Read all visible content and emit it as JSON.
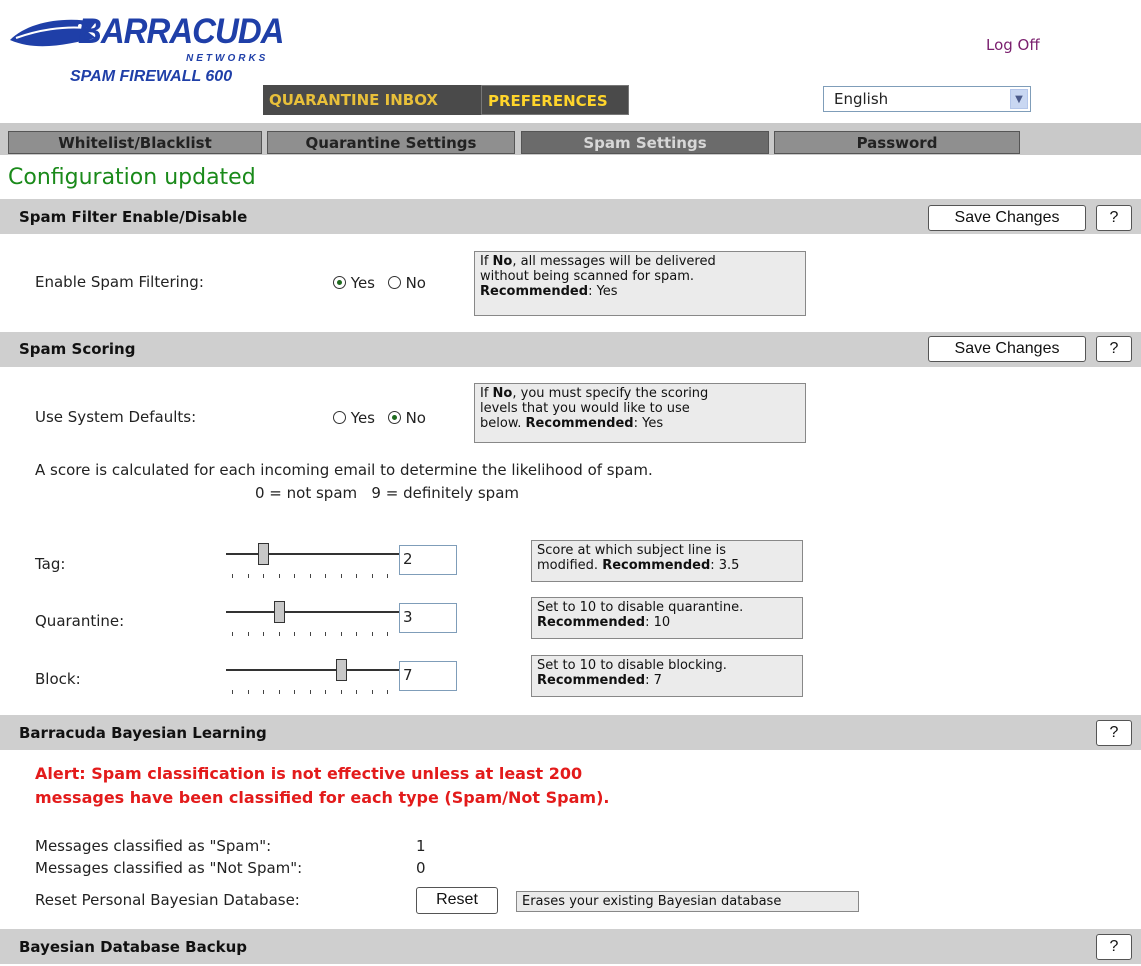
{
  "header": {
    "logo_word": "BARRACUDA",
    "logo_networks": "NETWORKS",
    "logo_product": "SPAM FIREWALL 600",
    "logoff": "Log Off",
    "tabs": [
      {
        "label": "QUARANTINE INBOX"
      },
      {
        "label": "PREFERENCES"
      }
    ],
    "language": "English"
  },
  "subnav": [
    {
      "label": "Whitelist/Blacklist"
    },
    {
      "label": "Quarantine Settings"
    },
    {
      "label": "Spam Settings",
      "active": true
    },
    {
      "label": "Password"
    }
  ],
  "status_message": "Configuration updated",
  "sections": {
    "filter": {
      "title": "Spam Filter Enable/Disable",
      "save_label": "Save Changes",
      "help_label": "?",
      "field_label": "Enable Spam Filtering:",
      "options": [
        "Yes",
        "No"
      ],
      "selected": "Yes",
      "note_line1_bold": "No",
      "note_line1_pre": "If ",
      "note_line1_post": ", all messages will be delivered",
      "note_line2": "without being scanned for spam.",
      "note_line3_bold": "Recommended",
      "note_line3_post": ": Yes"
    },
    "scoring": {
      "title": "Spam Scoring",
      "save_label": "Save Changes",
      "help_label": "?",
      "field_label": "Use System Defaults:",
      "options": [
        "Yes",
        "No"
      ],
      "selected": "No",
      "note_line1_pre": "If ",
      "note_line1_bold": "No",
      "note_line1_post": ", you must specify the scoring",
      "note_line2": "levels that you would like to use",
      "note_line3_pre": "below. ",
      "note_line3_bold": "Recommended",
      "note_line3_post": ": Yes",
      "desc_line1": "A score is calculated for each incoming email to determine the likelihood of spam.",
      "desc_line2": "0 = not spam   9 = definitely spam",
      "sliders": [
        {
          "label": "Tag:",
          "value": "2",
          "level": 2,
          "note1": "Score at which subject line is",
          "note2_pre": "modified. ",
          "note2_bold": "Recommended",
          "note2_post": ": 3.5"
        },
        {
          "label": "Quarantine:",
          "value": "3",
          "level": 3,
          "note1": "Set to 10 to disable quarantine.",
          "note2_pre": "",
          "note2_bold": "Recommended",
          "note2_post": ": 10"
        },
        {
          "label": "Block:",
          "value": "7",
          "level": 7,
          "note1": "Set to 10 to disable blocking.",
          "note2_pre": "",
          "note2_bold": "Recommended",
          "note2_post": ": 7"
        }
      ]
    },
    "bayesian": {
      "title": "Barracuda Bayesian Learning",
      "help_label": "?",
      "alert_line1": "Alert: Spam classification is not effective unless at least 200",
      "alert_line2": "messages have been classified for each type (Spam/Not Spam).",
      "spam_label": "Messages classified as \"Spam\":",
      "spam_count": "1",
      "notspam_label": "Messages classified as \"Not Spam\":",
      "notspam_count": "0",
      "reset_label": "Reset Personal Bayesian Database:",
      "reset_button": "Reset",
      "reset_note": "Erases your existing Bayesian database"
    },
    "backup": {
      "title": "Bayesian Database Backup",
      "help_label": "?"
    }
  },
  "colors": {
    "status_green": "#1a8a1a",
    "alert_red": "#e31b1b",
    "logo_blue": "#1f3fa8",
    "tab_yellow": "#ffd52b"
  }
}
